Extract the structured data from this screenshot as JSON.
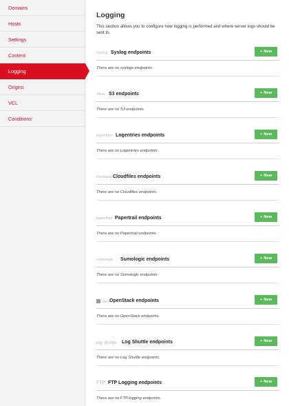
{
  "sidebar": {
    "items": [
      {
        "label": "Domains",
        "active": false
      },
      {
        "label": "Hosts",
        "active": false
      },
      {
        "label": "Settings",
        "active": false
      },
      {
        "label": "Content",
        "active": false
      },
      {
        "label": "Logging",
        "active": true
      },
      {
        "label": "Origins",
        "active": false
      },
      {
        "label": "VCL",
        "active": false
      },
      {
        "label": "Conditions",
        "active": false
      }
    ]
  },
  "main": {
    "title": "Logging",
    "description": "This section allows you to configure how logging is performed and where server logs should be sent to.",
    "new_button_label": "New",
    "sections": [
      {
        "logo": "Syslog",
        "title": "Syslog endpoints",
        "empty": "There are no syslogs endpoints."
      },
      {
        "logo": "Vbox",
        "title": "S3 endpoints",
        "empty": "There are no S3 endpoints."
      },
      {
        "logo": "logentries",
        "title": "Logentries endpoints",
        "empty": "There are no Logentries endpoints."
      },
      {
        "logo": "Rackspace",
        "title": "Cloudfiles endpoints",
        "empty": "There are no Cloudfiles endpoints."
      },
      {
        "logo": "papertrail",
        "title": "Papertrail endpoints",
        "empty": "There are no Papertrail endpoints."
      },
      {
        "logo": "sumologic",
        "title": "Sumologic endpoints",
        "empty": "There are no Sumologic endpoints."
      },
      {
        "logo": "stack",
        "title": "OpenStack endpoints",
        "empty": "There are no OpenStack endpoints."
      },
      {
        "logo": "log shuttle",
        "title": "Log Shuttle endpoints",
        "empty": "There are no Log Shuttle endpoints."
      },
      {
        "logo": "FTP",
        "title": "FTP Logging endpoints",
        "empty": "There are no FTP logging endpoints."
      }
    ]
  },
  "colors": {
    "accent_red": "#d81020",
    "button_green": "#5cb85c"
  },
  "icons": {
    "new_button_icon": "plus-icon"
  }
}
